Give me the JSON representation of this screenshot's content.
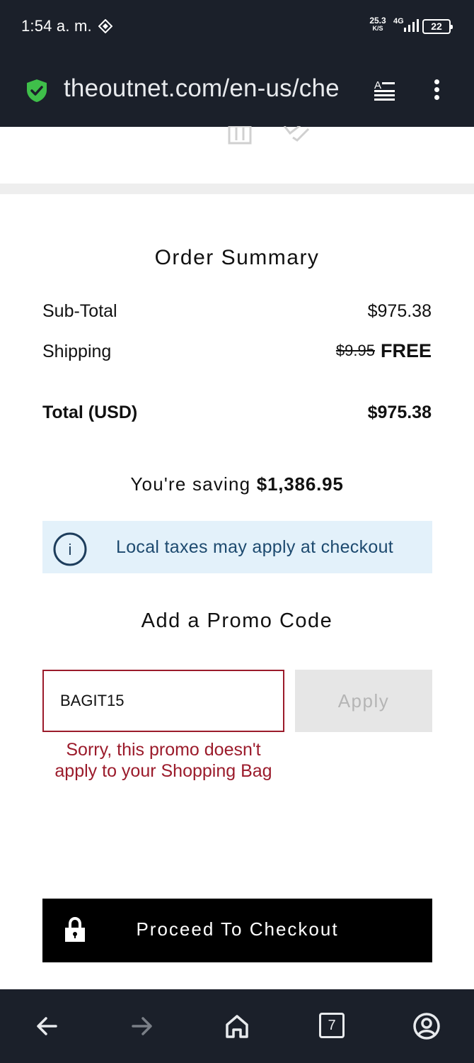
{
  "status_bar": {
    "time": "1:54 a. m.",
    "net_speed": "25.3",
    "net_unit": "K/S",
    "net_type": "4G",
    "battery": "22"
  },
  "browser": {
    "url": "theoutnet.com/en-us/che",
    "tab_count": "7",
    "colors": {
      "chrome_bg": "#1b202a",
      "secure_green": "#3fbf4a"
    }
  },
  "summary": {
    "title": "Order Summary",
    "subtotal_label": "Sub-Total",
    "subtotal_value": "$975.38",
    "shipping_label": "Shipping",
    "shipping_original": "$9.95",
    "shipping_value": "FREE",
    "total_label": "Total (USD)",
    "total_value": "$975.38",
    "saving_prefix": "You're saving",
    "saving_amount": "$1,386.95"
  },
  "tax_notice": {
    "text": "Local taxes may apply at checkout",
    "icon": "info-icon"
  },
  "promo": {
    "title": "Add a Promo Code",
    "input_value": "BAGIT15",
    "apply_label": "Apply",
    "error_line1": "Sorry, this promo doesn't",
    "error_line2": "apply to your Shopping Bag",
    "error_color": "#9b1b2b"
  },
  "checkout": {
    "label": "Proceed To Checkout",
    "icon": "lock-icon"
  }
}
